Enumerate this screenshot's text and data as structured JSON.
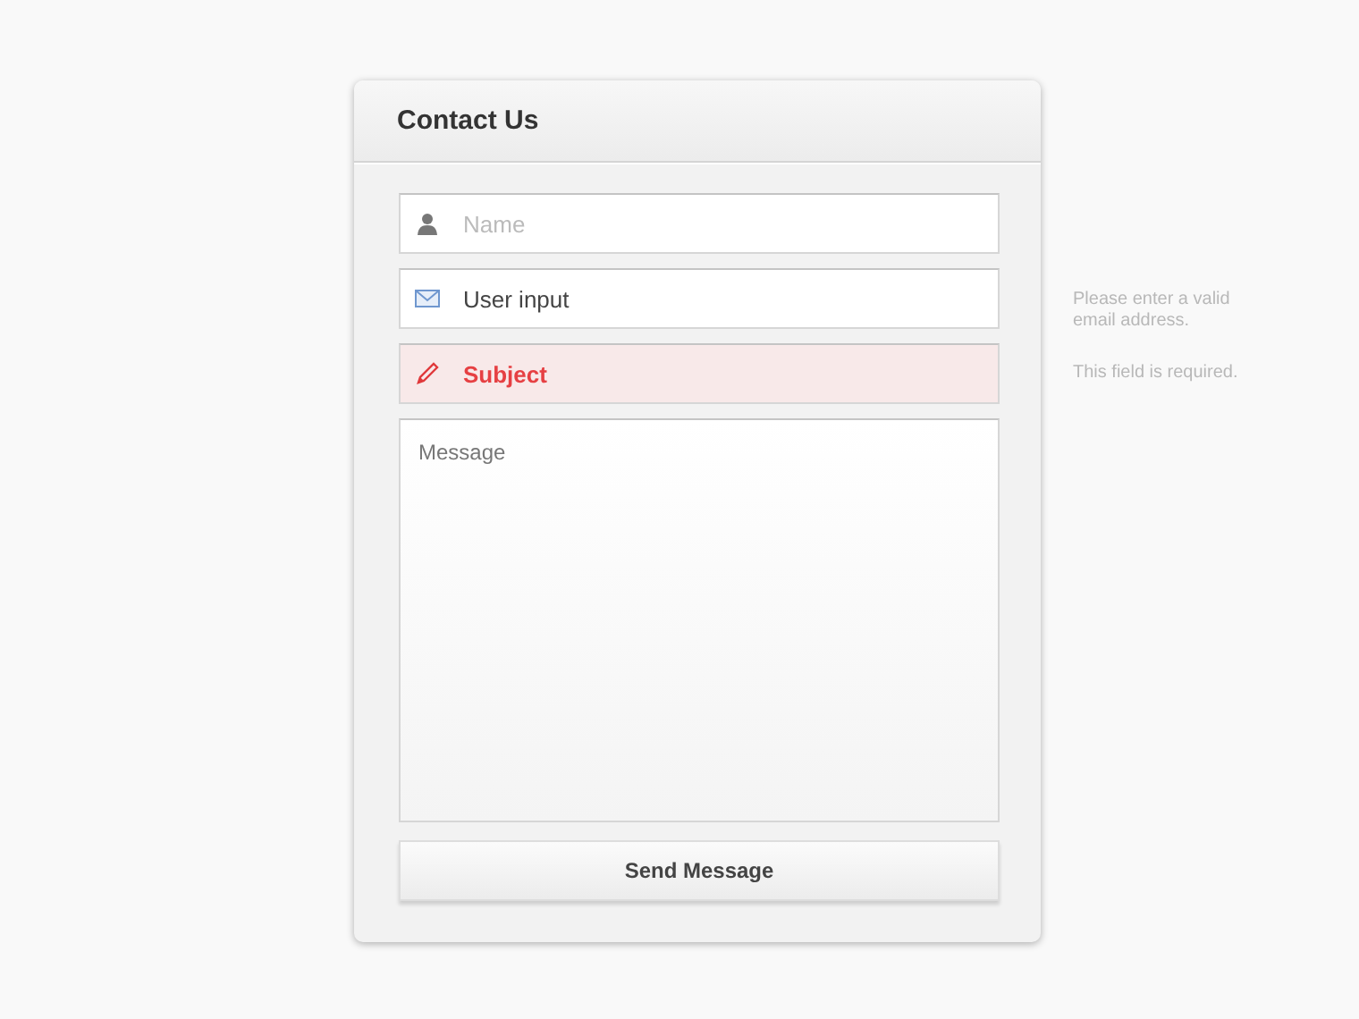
{
  "form": {
    "title": "Contact Us",
    "fields": [
      {
        "kind": "name",
        "placeholder": "Name",
        "error": false
      },
      {
        "kind": "email",
        "value": "User input",
        "error": false
      },
      {
        "kind": "subject",
        "placeholder": "Subject",
        "error": true
      }
    ],
    "message": {
      "placeholder": "Message"
    },
    "submit": "Send Message"
  },
  "notes": [
    "Please enter a valid email address.",
    "This field is required."
  ]
}
